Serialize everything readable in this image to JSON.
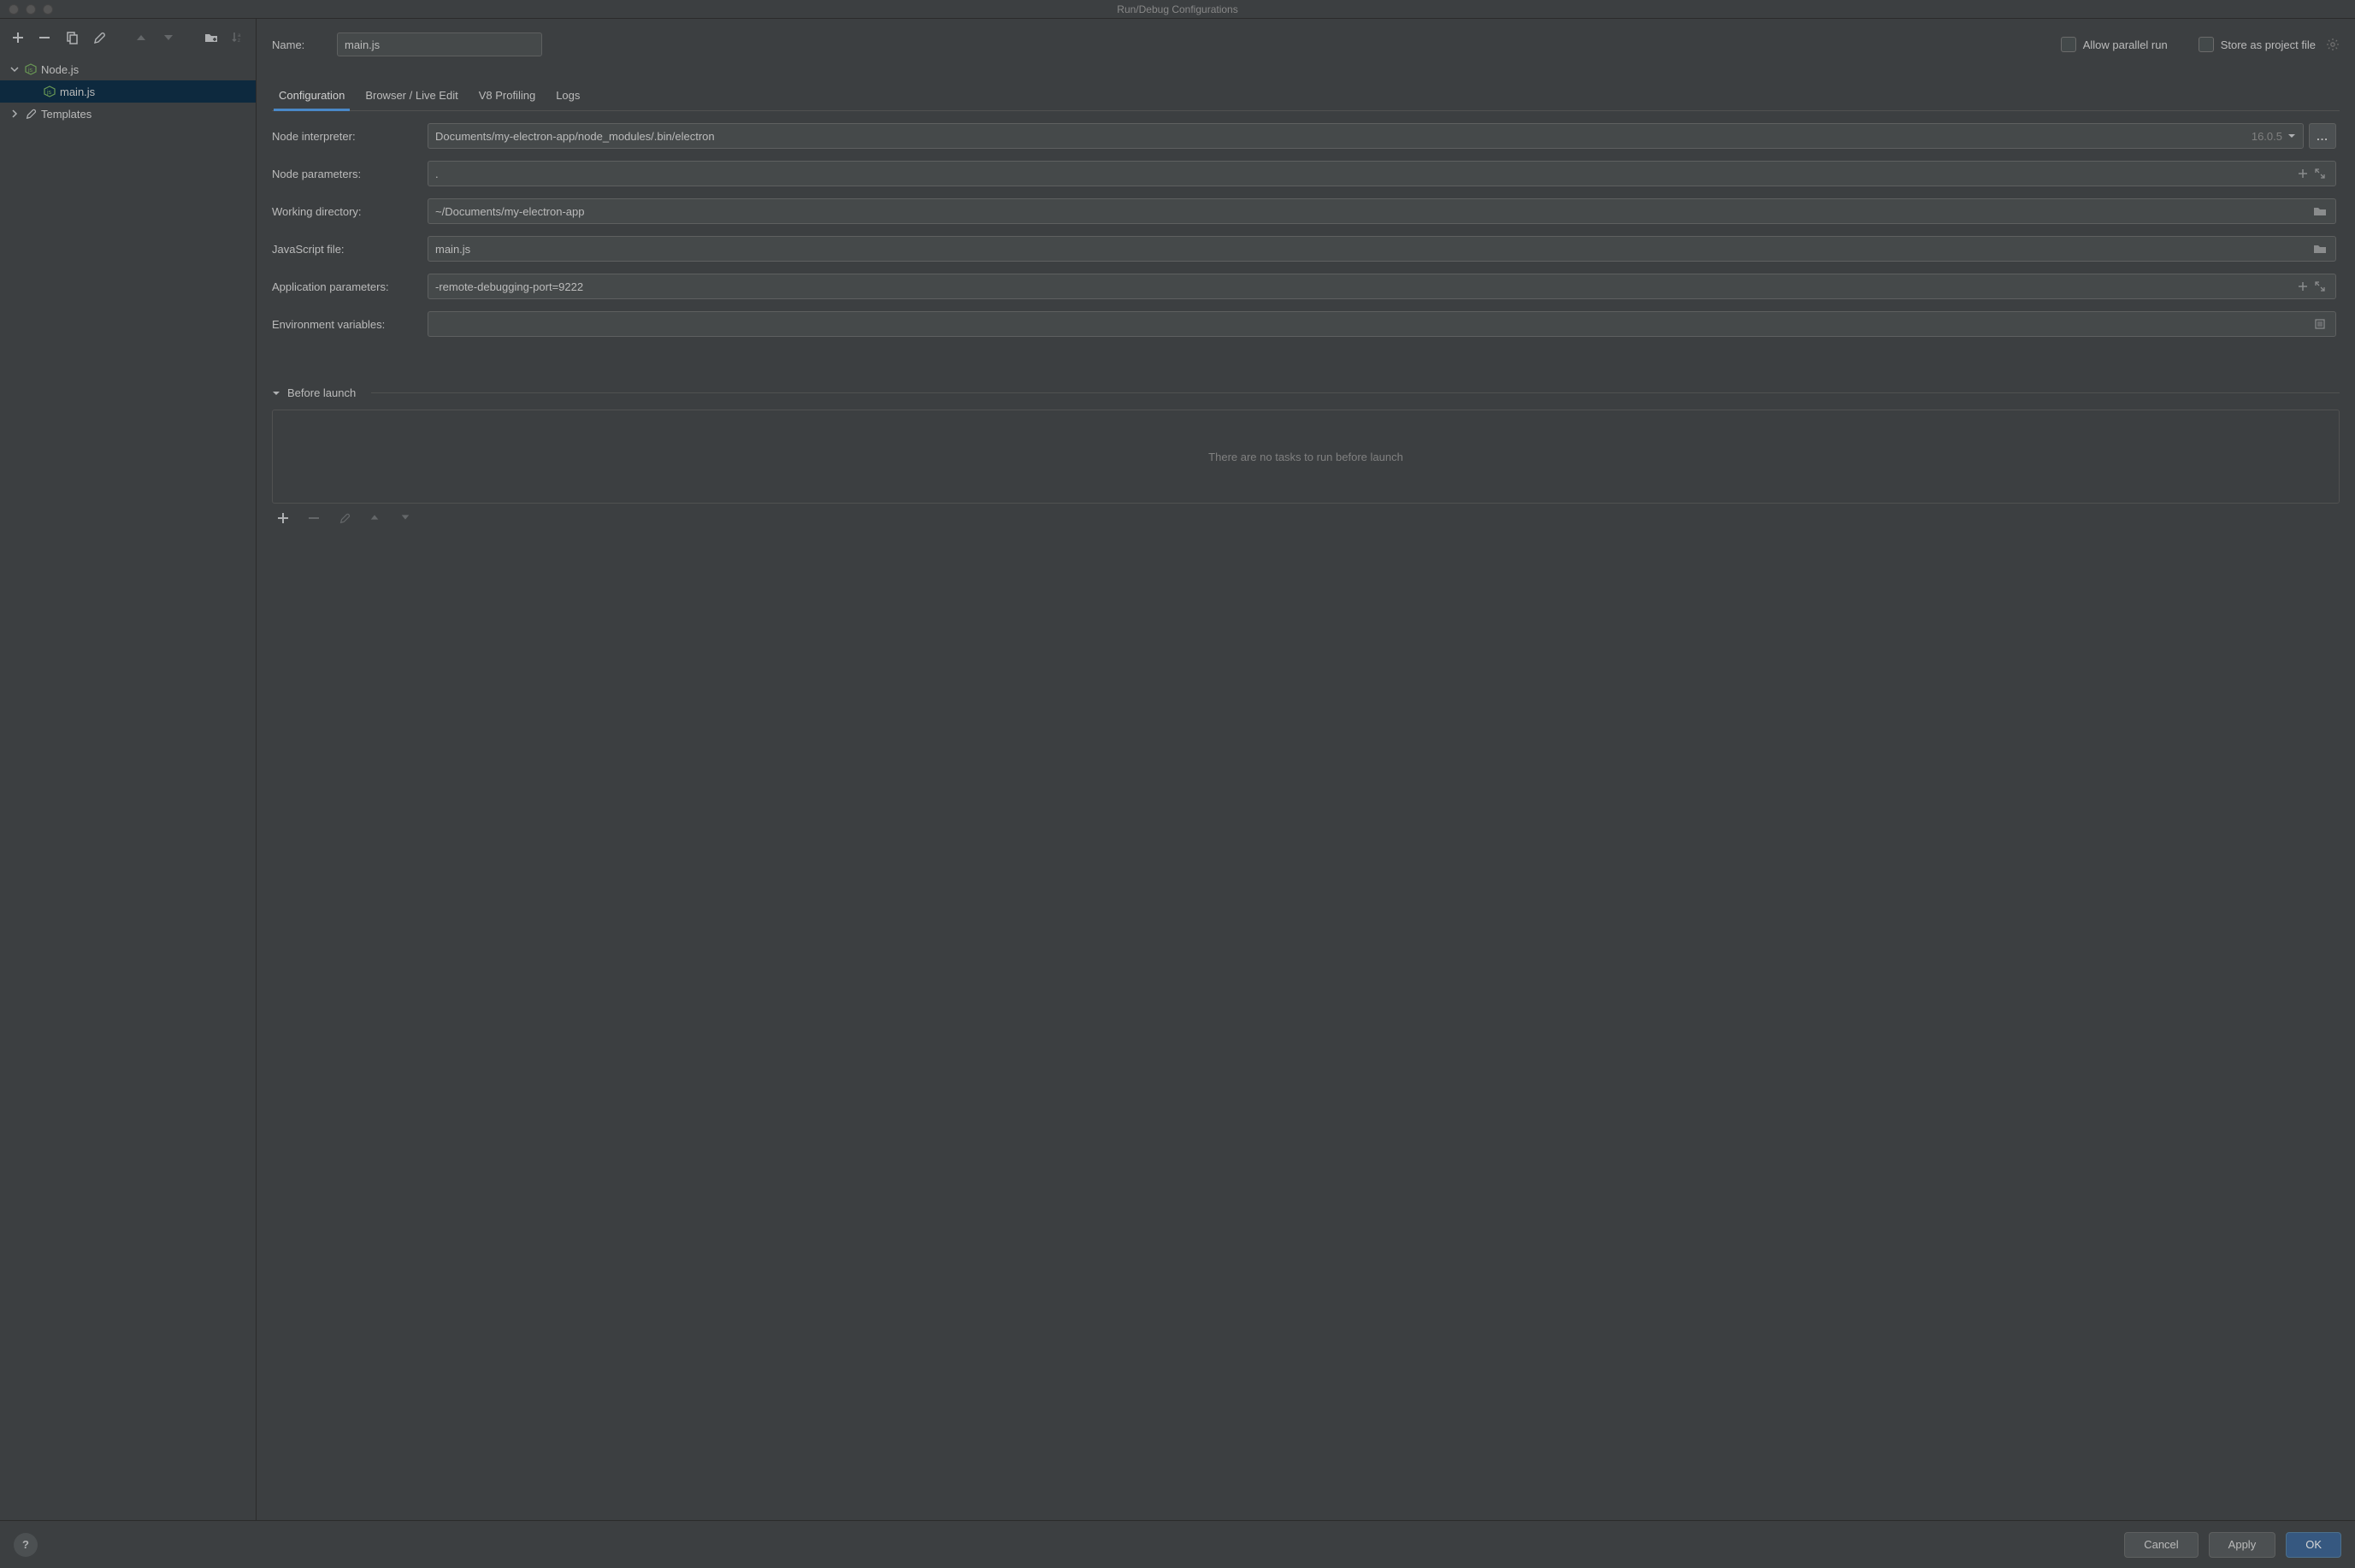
{
  "window": {
    "title": "Run/Debug Configurations"
  },
  "sidebar": {
    "items": [
      {
        "label": "Node.js",
        "expanded": true,
        "icon": "nodejs"
      },
      {
        "label": "main.js",
        "selected": true,
        "icon": "nodejs"
      },
      {
        "label": "Templates",
        "expanded": false,
        "icon": "wrench"
      }
    ]
  },
  "name": {
    "label": "Name:",
    "value": "main.js"
  },
  "options": {
    "allow_parallel": "Allow parallel run",
    "store_project": "Store as project file"
  },
  "tabs": [
    {
      "label": "Configuration",
      "active": true
    },
    {
      "label": "Browser / Live Edit"
    },
    {
      "label": "V8 Profiling"
    },
    {
      "label": "Logs"
    }
  ],
  "form": {
    "node_interpreter": {
      "label": "Node interpreter:",
      "value": "Documents/my-electron-app/node_modules/.bin/electron",
      "version": "16.0.5",
      "browse": "..."
    },
    "node_parameters": {
      "label": "Node parameters:",
      "value": "."
    },
    "working_directory": {
      "label": "Working directory:",
      "value": "~/Documents/my-electron-app"
    },
    "javascript_file": {
      "label": "JavaScript file:",
      "value": "main.js"
    },
    "application_parameters": {
      "label": "Application parameters:",
      "value": "-remote-debugging-port=9222"
    },
    "environment_variables": {
      "label": "Environment variables:",
      "value": ""
    }
  },
  "before_launch": {
    "title": "Before launch",
    "empty_text": "There are no tasks to run before launch"
  },
  "footer": {
    "help": "?",
    "cancel": "Cancel",
    "apply": "Apply",
    "ok": "OK"
  }
}
